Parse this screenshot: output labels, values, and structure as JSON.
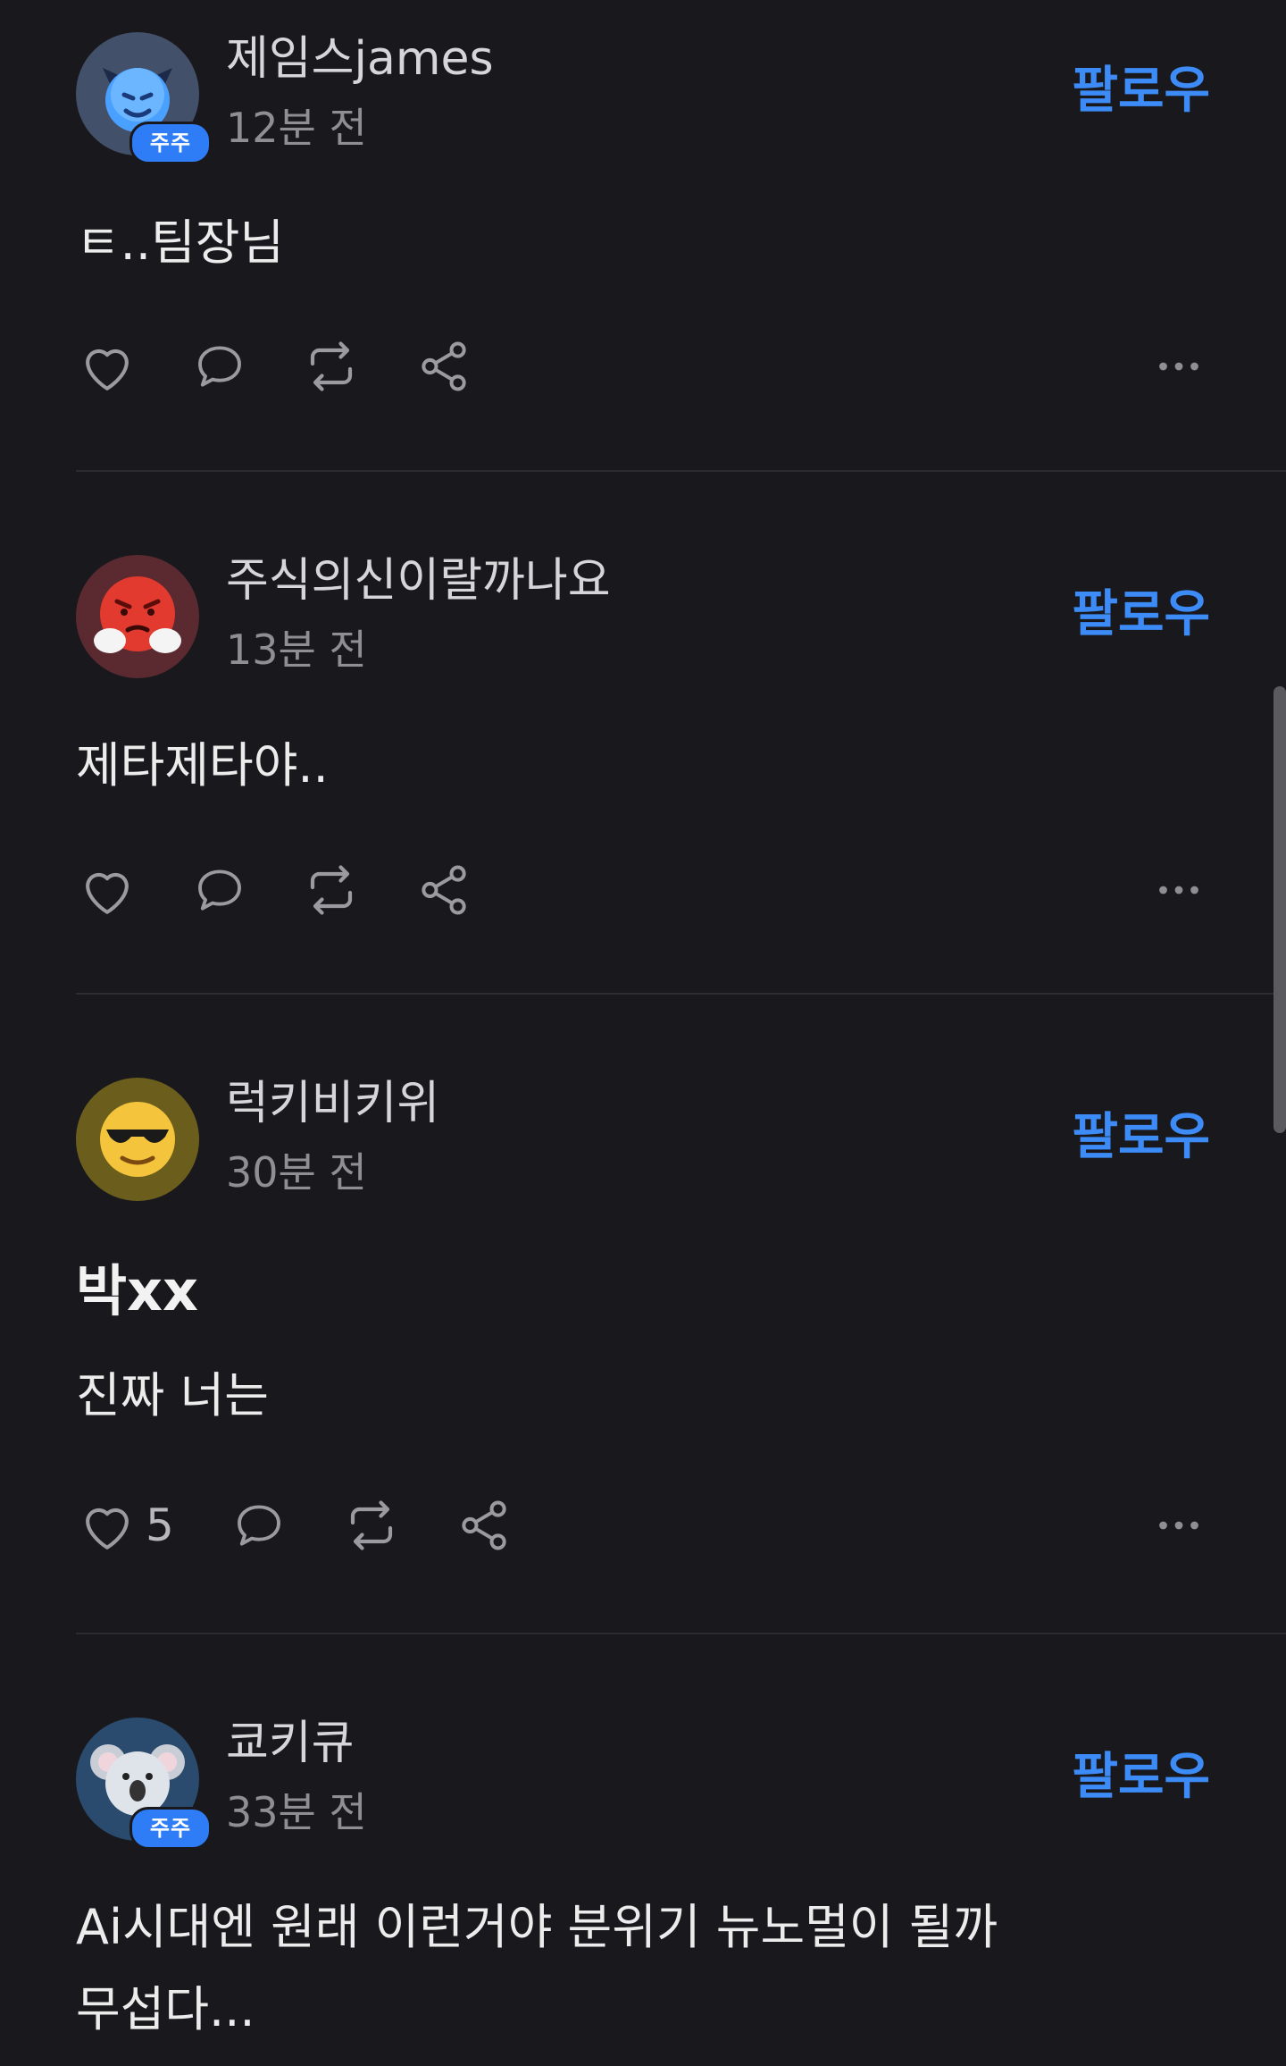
{
  "follow_label": "팔로우",
  "posts": [
    {
      "username": "제임스james",
      "time": "12분 전",
      "badge": "주주",
      "avatar_icon": "blue-devil-emoji-icon",
      "content": "ㅌ..팀장님",
      "likes": ""
    },
    {
      "username": "주식의신이랄까나요",
      "time": "13분 전",
      "badge": "",
      "avatar_icon": "angry-face-steam-emoji-icon",
      "content": "제타제타야..",
      "likes": ""
    },
    {
      "username": "럭키비키위",
      "time": "30분 전",
      "badge": "",
      "avatar_icon": "sunglasses-face-emoji-icon",
      "title": "박xx",
      "content": "진짜 너는",
      "likes": "5"
    },
    {
      "username": "쿄키큐",
      "time": "33분 전",
      "badge": "주주",
      "avatar_icon": "koala-emoji-icon",
      "content_line1": "Ai시대엔 원래 이런거야 분위기 뉴노멀이 될까",
      "content_line2": "무섭다..."
    }
  ],
  "colors": {
    "background": "#19191d",
    "accent": "#3d8bf7",
    "badge": "#2e7cf6",
    "secondary_text": "#8e8e93",
    "divider": "#2c2c31"
  }
}
